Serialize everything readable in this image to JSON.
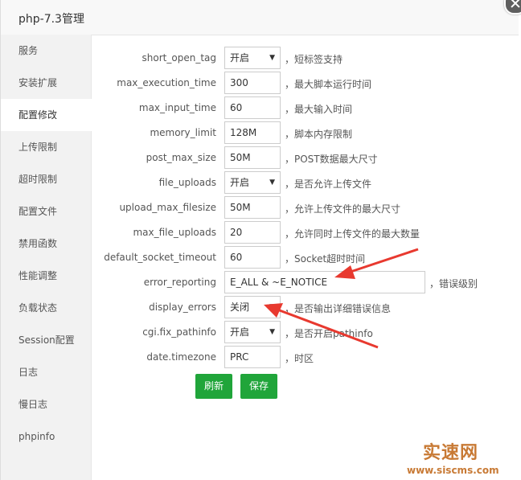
{
  "title": "php-7.3管理",
  "sidebar": {
    "items": [
      {
        "label": "服务"
      },
      {
        "label": "安装扩展"
      },
      {
        "label": "配置修改"
      },
      {
        "label": "上传限制"
      },
      {
        "label": "超时限制"
      },
      {
        "label": "配置文件"
      },
      {
        "label": "禁用函数"
      },
      {
        "label": "性能调整"
      },
      {
        "label": "负载状态"
      },
      {
        "label": "Session配置"
      },
      {
        "label": "日志"
      },
      {
        "label": "慢日志"
      },
      {
        "label": "phpinfo"
      }
    ]
  },
  "form": {
    "rows": [
      {
        "label": "short_open_tag",
        "value": "开启",
        "desc": "，短标签支持"
      },
      {
        "label": "max_execution_time",
        "value": "300",
        "desc": "，最大脚本运行时间"
      },
      {
        "label": "max_input_time",
        "value": "60",
        "desc": "，最大输入时间"
      },
      {
        "label": "memory_limit",
        "value": "128M",
        "desc": "，脚本内存限制"
      },
      {
        "label": "post_max_size",
        "value": "50M",
        "desc": "，POST数据最大尺寸"
      },
      {
        "label": "file_uploads",
        "value": "开启",
        "desc": "，是否允许上传文件"
      },
      {
        "label": "upload_max_filesize",
        "value": "50M",
        "desc": "，允许上传文件的最大尺寸"
      },
      {
        "label": "max_file_uploads",
        "value": "20",
        "desc": "，允许同时上传文件的最大数量"
      },
      {
        "label": "default_socket_timeout",
        "value": "60",
        "desc": "，Socket超时时间"
      },
      {
        "label": "error_reporting",
        "value": "E_ALL & ~E_NOTICE",
        "desc": "，错误级别"
      },
      {
        "label": "display_errors",
        "value": "关闭",
        "desc": "，是否输出详细错误信息"
      },
      {
        "label": "cgi.fix_pathinfo",
        "value": "开启",
        "desc": "，是否开启pathinfo"
      },
      {
        "label": "date.timezone",
        "value": "PRC",
        "desc": "，时区"
      }
    ]
  },
  "buttons": {
    "refresh": "刷新",
    "save": "保存"
  },
  "watermark": {
    "name": "实速网",
    "url": "www.siscms.com"
  },
  "colors": {
    "accent": "#20a53a",
    "arrow": "#e8392f"
  }
}
